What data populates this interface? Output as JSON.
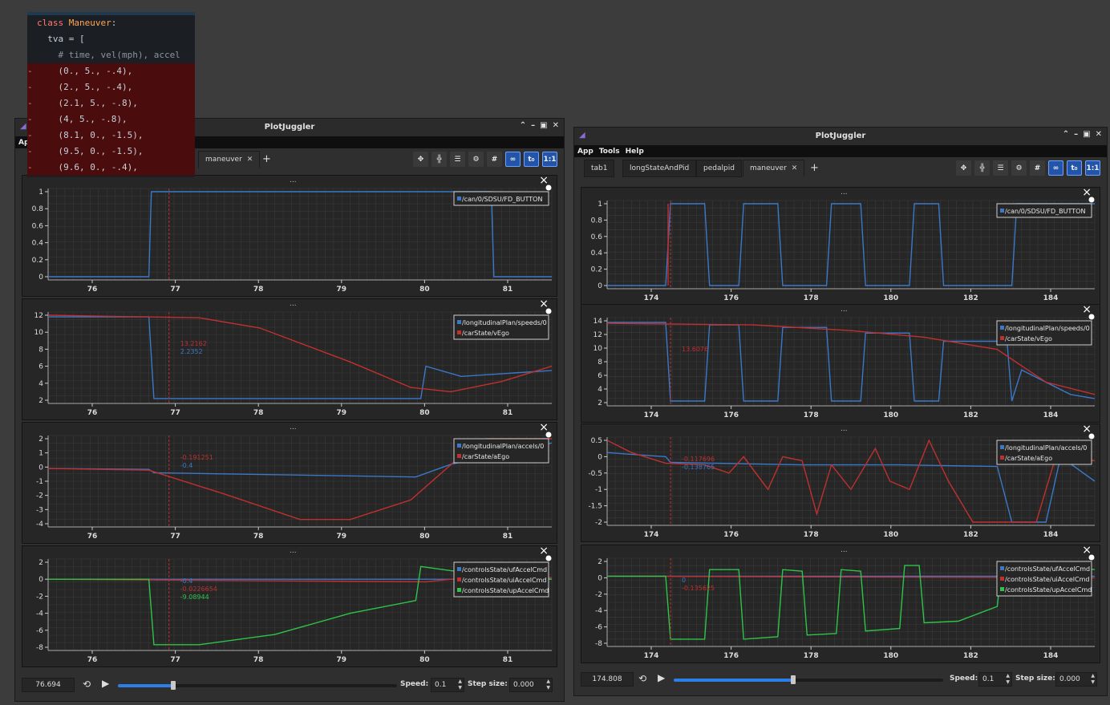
{
  "code": {
    "lines": [
      {
        "text": "class Maneuver:",
        "removed": false
      },
      {
        "text": "  tva = [",
        "removed": false
      },
      {
        "text": "    # time, vel(mph), accel",
        "removed": false
      },
      {
        "text": "    (0., 5., -.4),",
        "removed": true
      },
      {
        "text": "    (2., 5., -.4),",
        "removed": true
      },
      {
        "text": "    (2.1, 5., -.8),",
        "removed": true
      },
      {
        "text": "    (4, 5., -.8),",
        "removed": true
      },
      {
        "text": "    (8.1, 0., -1.5),",
        "removed": true
      },
      {
        "text": "    (9.5, 0., -1.5),",
        "removed": true
      },
      {
        "text": "    (9.6, 0., -.4),",
        "removed": true
      }
    ],
    "diff_marker": "-"
  },
  "windows": [
    {
      "title": "PlotJuggler",
      "menu_partial": "Ap",
      "tabs": [
        "maneuver"
      ],
      "time_value": "76.694",
      "speed_label": "Speed:",
      "speed_value": "0.1",
      "step_label": "Step size:",
      "step_value": "0.000",
      "slider_fraction": 0.44,
      "panels": [
        {
          "xticks": [
            "76",
            "77",
            "78",
            "79",
            "80",
            "81"
          ],
          "yticks": [
            "1",
            "0.8",
            "0.6",
            "0.4",
            "0.2",
            "0"
          ],
          "legend": [
            "/can/0/SDSU/FD_BUTTON"
          ],
          "cursor_values": []
        },
        {
          "xticks": [
            "76",
            "77",
            "78",
            "79",
            "80",
            "81"
          ],
          "yticks": [
            "12",
            "10",
            "8",
            "6",
            "4",
            "2"
          ],
          "legend": [
            "/longitudinalPlan/speeds/0",
            "/carState/vEgo"
          ],
          "cursor_values": [
            "13.2162",
            "2.2352"
          ]
        },
        {
          "xticks": [
            "76",
            "77",
            "78",
            "79",
            "80",
            "81"
          ],
          "yticks": [
            "2",
            "1",
            "0",
            "-1",
            "-2",
            "-3",
            "-4"
          ],
          "legend": [
            "/longitudinalPlan/accels/0",
            "/carState/aEgo"
          ],
          "cursor_values": [
            "-0.191251",
            "-0.4"
          ]
        },
        {
          "xticks": [
            "76",
            "77",
            "78",
            "79",
            "80",
            "81"
          ],
          "yticks": [
            "2",
            "0",
            "-2",
            "-4",
            "-6",
            "-8"
          ],
          "legend": [
            "/controlsState/ufAccelCmd",
            "/controlsState/uiAccelCmd",
            "/controlsState/upAccelCmd"
          ],
          "cursor_values": [
            "-0.4",
            "-0.0226654",
            "-9.08944"
          ]
        }
      ]
    },
    {
      "title": "PlotJuggler",
      "menu": [
        "App",
        "Tools",
        "Help"
      ],
      "tabs": [
        "tab1",
        "longStateAndPid",
        "pedalpid",
        "maneuver"
      ],
      "time_value": "174.808",
      "speed_label": "Speed:",
      "speed_value": "0.1",
      "step_label": "Step size:",
      "step_value": "0.000",
      "slider_fraction": 0.44,
      "panels": [
        {
          "xticks": [
            "174",
            "176",
            "178",
            "180",
            "182",
            "184"
          ],
          "yticks": [
            "1",
            "0.8",
            "0.6",
            "0.4",
            "0.2",
            "0"
          ],
          "legend": [
            "/can/0/SDSU/FD_BUTTON"
          ],
          "cursor_values": []
        },
        {
          "xticks": [
            "174",
            "176",
            "178",
            "180",
            "182",
            "184"
          ],
          "yticks": [
            "14",
            "12",
            "10",
            "8",
            "6",
            "4",
            "2"
          ],
          "legend": [
            "/longitudinalPlan/speeds/0",
            "/carState/vEgo"
          ],
          "cursor_values": [
            "13.6076"
          ]
        },
        {
          "xticks": [
            "174",
            "176",
            "178",
            "180",
            "182",
            "184"
          ],
          "yticks": [
            "0.5",
            "0",
            "-0.5",
            "-1",
            "-1.5",
            "-2"
          ],
          "legend": [
            "/longitudinalPlan/accels/0",
            "/carState/aEgo"
          ],
          "cursor_values": [
            "-0.117696",
            "-0.138765"
          ]
        },
        {
          "xticks": [
            "174",
            "176",
            "178",
            "180",
            "182",
            "184"
          ],
          "yticks": [
            "2",
            "0",
            "-2",
            "-4",
            "-6",
            "-8"
          ],
          "legend": [
            "/controlsState/ufAccelCmd",
            "/controlsState/uiAccelCmd",
            "/controlsState/upAccelCmd"
          ],
          "cursor_values": [
            "0",
            "-0.135625"
          ]
        }
      ]
    }
  ],
  "panel_title": "...",
  "colors": {
    "blue": "#3a78c8",
    "red": "#c0302e",
    "green": "#2ec44a",
    "grid": "#4a4a4a",
    "accent": "#2c7fe8"
  }
}
